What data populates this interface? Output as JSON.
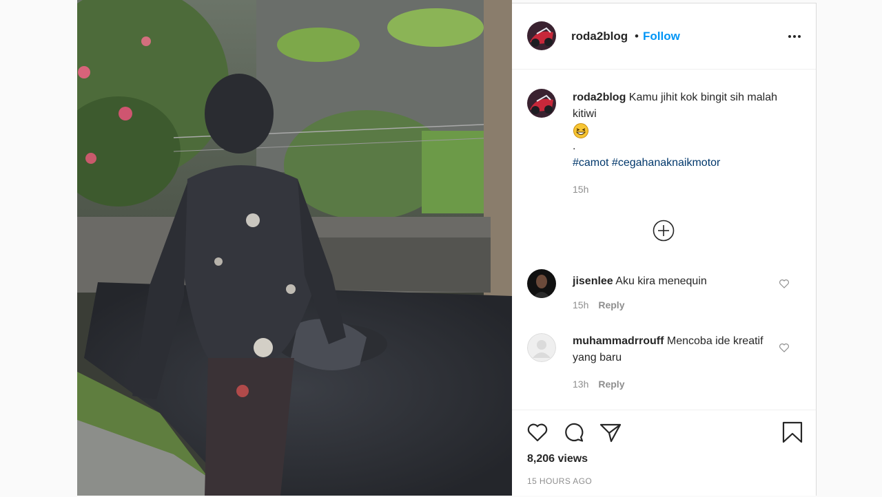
{
  "post": {
    "username": "roda2blog",
    "follow_label": "Follow",
    "separator": "•",
    "more_icon": "more-options-icon"
  },
  "caption": {
    "username": "roda2blog",
    "text": "Kamu jihit kok bingit sih malah kitiwi",
    "emoji": "grinning-squinting-face",
    "dot": ".",
    "hashtags": [
      "#camot",
      "#cegahanaknaikmotor"
    ],
    "time": "15h"
  },
  "load_more_icon": "plus-circle-icon",
  "comments": [
    {
      "username": "jisenlee",
      "text": "Aku kira menequin",
      "time": "15h",
      "reply": "Reply"
    },
    {
      "username": "muhammadrrouff",
      "text": "Mencoba ide kreatif yang baru",
      "time": "13h",
      "reply": "Reply"
    }
  ],
  "actions": {
    "icons": [
      "heart-icon",
      "comment-icon",
      "share-icon",
      "bookmark-icon"
    ],
    "views": "8,206 views",
    "posted": "15 HOURS AGO"
  },
  "colors": {
    "accent": "#0095f6",
    "hashtag": "#00376b",
    "muted": "#8e8e8e",
    "text": "#262626"
  }
}
